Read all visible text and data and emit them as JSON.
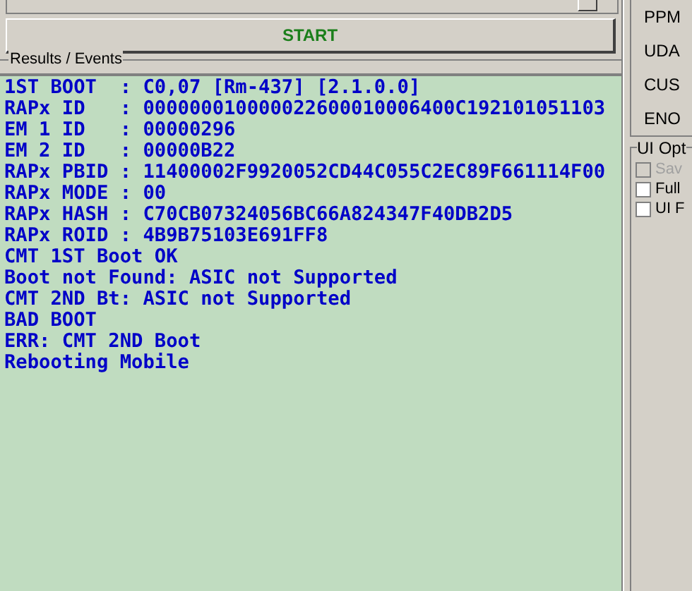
{
  "start_button": {
    "label": "START"
  },
  "results": {
    "title": "Results / Events",
    "lines": [
      "1ST BOOT  : C0,07 [Rm-437] [2.1.0.0]",
      "RAPx ID   : 000000010000022600010006400C192101051103",
      "EM 1 ID   : 00000296",
      "EM 2 ID   : 00000B22",
      "RAPx PBID : 11400002F9920052CD44C055C2EC89F661114F00",
      "RAPx MODE : 00",
      "RAPx HASH : C70CB07324056BC66A824347F40DB2D5",
      "RAPx ROID : 4B9B75103E691FF8",
      "CMT 1ST Boot OK",
      "Boot not Found: ASIC not Supported",
      "CMT 2ND Bt: ASIC not Supported",
      "BAD BOOT",
      "ERR: CMT 2ND Boot",
      "Rebooting Mobile"
    ]
  },
  "side_labels": [
    "PPM",
    "UDA",
    "CUS",
    "ENO"
  ],
  "ui_options": {
    "title": "UI Opt",
    "items": [
      {
        "label": "Sav",
        "checked": false,
        "disabled": true
      },
      {
        "label": "Full",
        "checked": false,
        "disabled": false
      },
      {
        "label": "UI F",
        "checked": false,
        "disabled": false
      }
    ]
  }
}
